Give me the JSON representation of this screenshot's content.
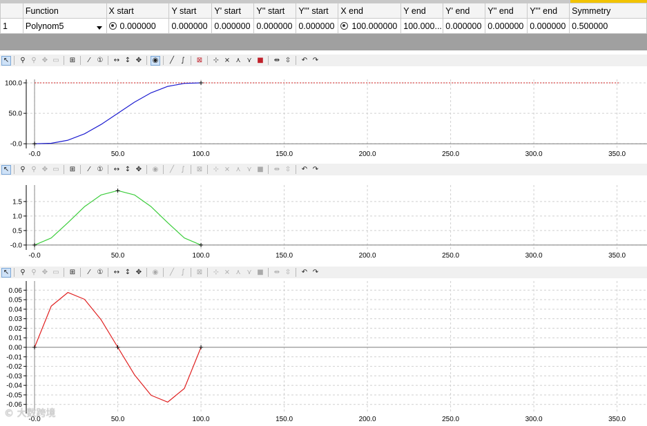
{
  "table": {
    "headers": [
      "",
      "Function",
      "X start",
      "Y start",
      "Y' start",
      "Y'' start",
      "Y''' start",
      "X end",
      "Y end",
      "Y' end",
      "Y'' end",
      "Y''' end",
      "Symmetry"
    ],
    "row": {
      "index": "1",
      "function": "Polynom5",
      "x_start": "0.000000",
      "y_start": "0.000000",
      "y1_start": "0.000000",
      "y2_start": "0.000000",
      "y3_start": "0.000000",
      "x_end": "100.000000",
      "y_end": "100.000...",
      "y1_end": "0.000000",
      "y2_end": "0.000000",
      "y3_end": "0.000000",
      "symmetry": "0.500000"
    }
  },
  "toolbar_icons": [
    "pointer-icon",
    "zoom-in-icon",
    "zoom-out-icon",
    "pan-icon",
    "zoom-box-icon",
    "grid-icon",
    "draw-line-icon",
    "info-icon",
    "horizontal-arrows-icon",
    "vertical-arrows-icon",
    "move-icon",
    "point-icon",
    "line-segment-icon",
    "curve-icon",
    "delete-icon",
    "split-icon",
    "join-icon",
    "branch-icon",
    "vertical-tangent-icon",
    "stop-icon",
    "expand-icon",
    "collapse-icon",
    "undo-icon",
    "redo-icon"
  ],
  "watermark": "© 大数跨境",
  "chart_data": [
    {
      "type": "line",
      "title": "",
      "x_tick_labels": [
        "-0.0",
        "50.0",
        "100.0",
        "150.0",
        "200.0",
        "250.0",
        "300.0",
        "350.0"
      ],
      "y_tick_labels": [
        "-0.0",
        "50.0",
        "100.0"
      ],
      "xlim": [
        -5,
        368
      ],
      "ylim": [
        -2,
        100
      ],
      "series": [
        {
          "color": "#1c1cd0",
          "x": [
            0,
            10,
            20,
            30,
            40,
            50,
            60,
            70,
            80,
            90,
            100
          ],
          "y": [
            0,
            0.86,
            5.79,
            16.31,
            31.74,
            50,
            68.26,
            83.69,
            94.21,
            99.14,
            100
          ]
        }
      ],
      "reference_line": {
        "y": 100,
        "color": "#d01818",
        "style": "dotted"
      },
      "grid": true
    },
    {
      "type": "line",
      "title": "",
      "x_tick_labels": [
        "-0.0",
        "50.0",
        "100.0",
        "150.0",
        "200.0",
        "250.0",
        "300.0",
        "350.0"
      ],
      "y_tick_labels": [
        "-0.0",
        "0.5",
        "1.0",
        "1.5"
      ],
      "xlim": [
        -5,
        368
      ],
      "ylim": [
        -0.05,
        1.95
      ],
      "series": [
        {
          "color": "#3ccd3c",
          "x": [
            0,
            10,
            20,
            30,
            40,
            50,
            60,
            70,
            80,
            90,
            100
          ],
          "y": [
            0,
            0.243,
            0.768,
            1.323,
            1.728,
            1.875,
            1.728,
            1.323,
            0.768,
            0.243,
            0
          ]
        }
      ],
      "grid": true
    },
    {
      "type": "line",
      "title": "",
      "x_tick_labels": [
        "-0.0",
        "50.0",
        "100.0",
        "150.0",
        "200.0",
        "250.0",
        "300.0",
        "350.0"
      ],
      "y_tick_labels": [
        "0.06",
        "0.05",
        "0.04",
        "0.03",
        "0.02",
        "0.01",
        "0.00",
        "-0.01",
        "-0.02",
        "-0.03",
        "-0.04",
        "-0.05",
        "-0.06"
      ],
      "xlim": [
        -5,
        368
      ],
      "ylim": [
        -0.066,
        0.066
      ],
      "series": [
        {
          "color": "#e02020",
          "x": [
            0,
            10,
            20,
            30,
            40,
            50,
            60,
            70,
            80,
            90,
            100
          ],
          "y": [
            0,
            0.0432,
            0.0576,
            0.0504,
            0.0288,
            0,
            -0.0288,
            -0.0504,
            -0.0576,
            -0.0432,
            0
          ]
        }
      ],
      "grid": true
    }
  ]
}
